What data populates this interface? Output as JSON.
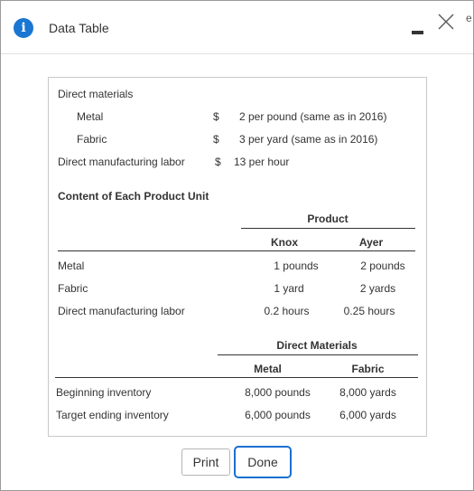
{
  "window": {
    "title": "Data Table",
    "edge_char": "e"
  },
  "prices": {
    "rows": [
      {
        "label": "Direct materials",
        "dollar": "",
        "value": ""
      },
      {
        "label": "Metal",
        "dollar": "$",
        "value": "2 per pound (same as in 2016)"
      },
      {
        "label": "Fabric",
        "dollar": "$",
        "value": "3 per yard (same as in 2016)"
      },
      {
        "label": "Direct manufacturing labor",
        "dollar": "$",
        "value": "13 per hour"
      }
    ]
  },
  "content": {
    "heading": "Content of Each Product Unit",
    "group_header": "Product",
    "columns": [
      "Knox",
      "Ayer"
    ],
    "rows": [
      {
        "label": "Metal",
        "values": [
          "1 pounds",
          "2 pounds"
        ]
      },
      {
        "label": "Fabric",
        "values": [
          "1 yard",
          "2 yards"
        ]
      },
      {
        "label": "Direct manufacturing labor",
        "values": [
          "0.2 hours",
          "0.25 hours"
        ]
      }
    ]
  },
  "inventory": {
    "group_header": "Direct Materials",
    "columns": [
      "Metal",
      "Fabric"
    ],
    "rows": [
      {
        "label": "Beginning inventory",
        "values": [
          "8,000 pounds",
          "8,000 yards"
        ]
      },
      {
        "label": "Target ending inventory",
        "values": [
          "6,000 pounds",
          "6,000 yards"
        ]
      }
    ]
  },
  "buttons": {
    "print": "Print",
    "done": "Done"
  },
  "colors": {
    "accent": "#1a6fd1",
    "info_icon": "#1976d2"
  }
}
